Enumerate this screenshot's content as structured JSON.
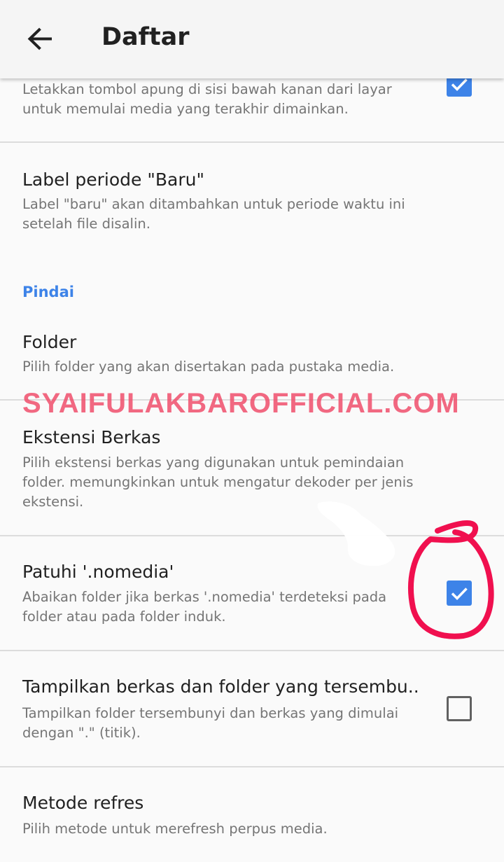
{
  "appbar": {
    "title": "Daftar",
    "back_icon": "arrow-back-icon"
  },
  "prefs": {
    "floating_button": {
      "summary": "Letakkan tombol apung di sisi bawah kanan dari layar untuk memulai media yang terakhir dimainkan.",
      "checked": true
    },
    "new_label": {
      "title": "Label periode \"Baru\"",
      "summary": "Label \"baru\" akan ditambahkan untuk periode waktu ini setelah file disalin."
    },
    "category_scan": "Pindai",
    "folder": {
      "title": "Folder",
      "summary": "Pilih folder yang akan disertakan pada pustaka media."
    },
    "extensions": {
      "title": "Ekstensi Berkas",
      "summary": "Pilih ekstensi berkas yang digunakan untuk pemindaian folder. memungkinkan untuk mengatur dekoder per jenis ekstensi."
    },
    "nomedia": {
      "title": "Patuhi '.nomedia'",
      "summary": "Abaikan folder jika berkas '.nomedia' terdeteksi pada folder atau pada folder induk.",
      "checked": true
    },
    "hidden": {
      "title": "Tampilkan berkas dan folder yang tersembu..",
      "summary": "Tampilkan folder tersembunyi dan berkas yang dimulai dengan \".\" (titik).",
      "checked": false
    },
    "refresh": {
      "title": "Metode refres",
      "summary": "Pilih metode untuk merefresh perpus media."
    }
  },
  "watermark": "SYAIFULAKBAROFFICIAL.COM",
  "colors": {
    "accent": "#3d83e8",
    "annotation": "#f0104f",
    "watermark": "#f04f6c"
  }
}
